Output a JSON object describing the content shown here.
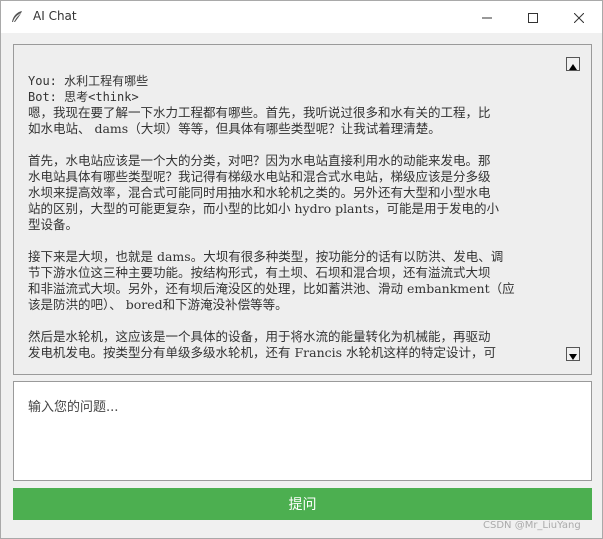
{
  "window": {
    "title": "AI Chat",
    "icons": {
      "app": "feather-icon",
      "minimize": "minimize-icon",
      "maximize": "maximize-icon",
      "close": "close-icon"
    }
  },
  "chat": {
    "user_line": "You: 水利工程有哪些",
    "bot_line": "Bot: 思考<think>",
    "paragraphs": [
      [
        "嗯，我现在要了解一下水力工程都有哪些。首先，我听说过很多和水有关的工程，比",
        "如水电站、 dams（大坝）等等，但具体有哪些类型呢？让我试着理清楚。"
      ],
      [
        "首先，水电站应该是一个大的分类，对吧？因为水电站直接利用水的动能来发电。那",
        "水电站具体有哪些类型呢？我记得有梯级水电站和混合式水电站，梯级应该是分多级",
        "水坝来提高效率，混合式可能同时用抽水和水轮机之类的。另外还有大型和小型水电",
        "站的区别，大型的可能更复杂，而小型的比如小 hydro plants，可能是用于发电的小",
        "型设备。"
      ],
      [
        "接下来是大坝，也就是 dams。大坝有很多种类型，按功能分的话有以防洪、发电、调",
        "节下游水位这三种主要功能。按结构形式，有土坝、石坝和混合坝，还有溢流式大坝",
        "和非溢流式大坝。另外，还有坝后淹没区的处理，比如蓄洪池、滑动 embankment（应",
        "该是防洪的吧）、 bored和下游淹没补偿等等。"
      ],
      [
        "然后是水轮机，这应该是一个具体的设备，用于将水流的能量转化为机械能，再驱动",
        "发电机发电。按类型分有单级多级水轮机，还有 Francis 水轮机这样的特定设计，可"
      ]
    ]
  },
  "input": {
    "placeholder": "输入您的问题..."
  },
  "ask_button": {
    "label": "提问",
    "color": "#4caf50"
  },
  "watermark": "CSDN @Mr_LiuYang"
}
